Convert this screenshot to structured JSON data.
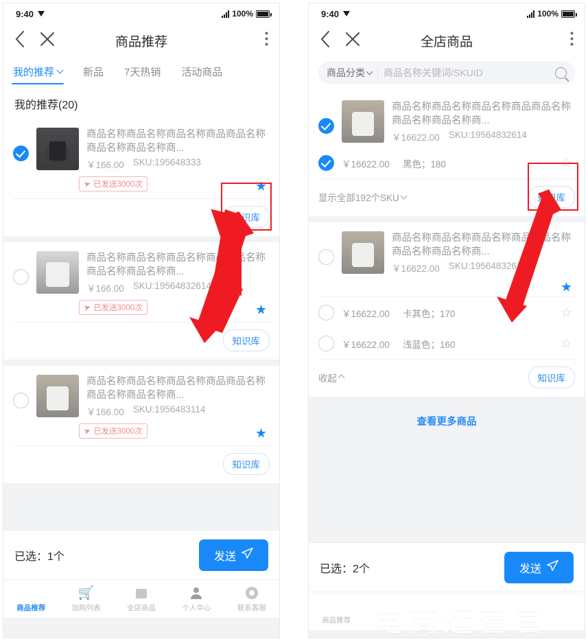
{
  "status_bar": {
    "time": "9:40",
    "battery_pct": "100%"
  },
  "colors": {
    "accent": "#1989fa",
    "link": "#2b8cf5",
    "annotation": "#ee1c22",
    "tag_red": "#f08b8b"
  },
  "left_panel": {
    "nav": {
      "title": "商品推荐",
      "back_icon": "chevron-left-icon",
      "close_icon": "close-icon",
      "more_icon": "more-vertical-icon"
    },
    "tabs": [
      {
        "label": "我的推荐",
        "active": true,
        "has_chevron": true
      },
      {
        "label": "新品",
        "active": false,
        "has_chevron": false
      },
      {
        "label": "7天热销",
        "active": false,
        "has_chevron": false
      },
      {
        "label": "活动商品",
        "active": false,
        "has_chevron": false
      }
    ],
    "section_title": "我的推荐(20)",
    "products": [
      {
        "checked": true,
        "name": "商品名称商品名称商品名称商品商品名称商品名称商品名称商...",
        "price": "￥166.00",
        "sku": "SKU:195648333",
        "sent_tag": "已发送3000次",
        "star": "filled",
        "kb_label": "知识库"
      },
      {
        "checked": false,
        "name": "商品名称商品名称商品名称商品商品名称商品名称商品名称商...",
        "price": "￥166.00",
        "sku": "SKU:19564832614",
        "sent_tag": "已发送3000次",
        "star": "filled",
        "kb_label": "知识库"
      },
      {
        "checked": false,
        "name": "商品名称商品名称商品名称商品商品名称商品名称商品名称商...",
        "price": "￥166.00",
        "sku": "SKU:1956483114",
        "sent_tag": "已发送3000次",
        "star": "filled",
        "kb_label": "知识库"
      }
    ],
    "selected_bar": {
      "label": "已选：1个",
      "send_label": "发送"
    },
    "tabbar": [
      {
        "label": "商品推荐",
        "icon": "bookmark-star-icon",
        "active": true
      },
      {
        "label": "加购列表",
        "icon": "cart-icon",
        "active": false
      },
      {
        "label": "全店商品",
        "icon": "shop-bag-icon",
        "active": false
      },
      {
        "label": "个人中心",
        "icon": "person-icon",
        "active": false
      },
      {
        "label": "联系客服",
        "icon": "headset-icon",
        "active": false
      }
    ]
  },
  "right_panel": {
    "nav": {
      "title": "全店商品",
      "back_icon": "chevron-left-icon",
      "close_icon": "close-icon",
      "more_icon": "more-vertical-icon"
    },
    "search": {
      "category_label": "商品分类",
      "placeholder": "商品名称关键词/SKUID",
      "search_icon": "search-icon"
    },
    "groups": [
      {
        "checked": true,
        "name": "商品名称商品名称商品名称商品商品名称商品名称商品名称商...",
        "price": "￥16622.00",
        "sku": "SKU:19564832614",
        "star": "none",
        "skus": [
          {
            "checked": true,
            "price": "￥16622.00",
            "spec": "黑色；180",
            "star": "empty"
          }
        ],
        "expand_label": "显示全部192个SKU",
        "expand_dir": "down",
        "kb_label": "知识库"
      },
      {
        "checked": false,
        "name": "商品名称商品名称商品名称商品商品名称商品名称商品名称商...",
        "price": "￥16622.00",
        "sku": "SKU:19564832614",
        "star": "filled",
        "skus": [
          {
            "checked": false,
            "price": "￥16622.00",
            "spec": "卡其色；170",
            "star": "empty"
          },
          {
            "checked": false,
            "price": "￥16622.00",
            "spec": "浅蓝色；160",
            "star": "empty"
          }
        ],
        "expand_label": "收起",
        "expand_dir": "up",
        "kb_label": "知识库"
      }
    ],
    "more_link": "查看更多商品",
    "selected_bar": {
      "label": "已选：2个",
      "send_label": "发送"
    },
    "tabbar": [
      {
        "label": "商品推荐",
        "icon": "bookmark-star-icon",
        "active": false
      }
    ],
    "watermark": "电商运营官"
  }
}
